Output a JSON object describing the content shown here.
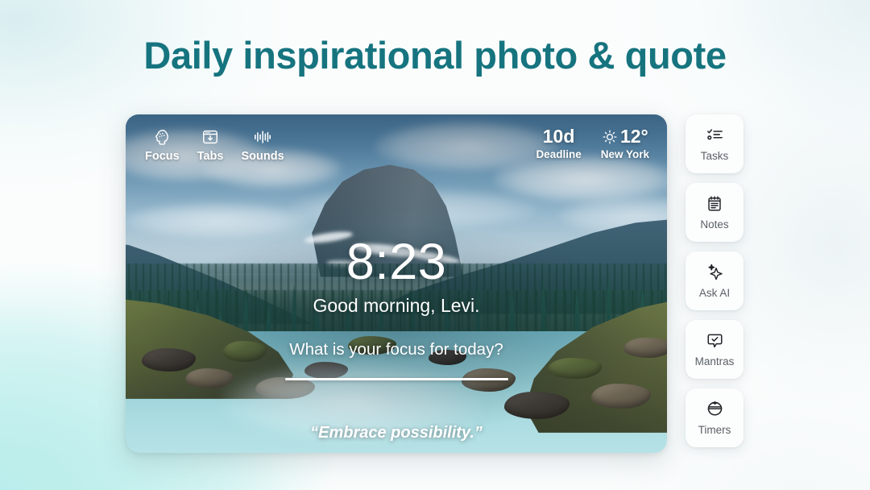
{
  "headline": "Daily inspirational photo & quote",
  "theme": {
    "headline_color": "#16747f",
    "background_tint": "#b8ecea",
    "card_surface": "#fcfdfd",
    "overlay_text": "#ffffff",
    "sidebar_label_color": "#5a6166"
  },
  "dashboard": {
    "toolbar": [
      {
        "label": "Focus",
        "icon": "brain-head-icon"
      },
      {
        "label": "Tabs",
        "icon": "window-download-icon"
      },
      {
        "label": "Sounds",
        "icon": "sound-waves-icon"
      }
    ],
    "stats": [
      {
        "value": "10d",
        "label": "Deadline",
        "icon": "none"
      },
      {
        "value": "12°",
        "label": "New York",
        "icon": "sun-icon"
      }
    ],
    "clock": "8:23",
    "greeting": "Good morning, Levi.",
    "focus_prompt": "What is your focus for today?",
    "focus_input_value": "",
    "quote": "“Embrace possibility.”"
  },
  "sidebar": {
    "items": [
      {
        "label": "Tasks",
        "icon": "checklist-icon"
      },
      {
        "label": "Notes",
        "icon": "notepad-icon"
      },
      {
        "label": "Ask AI",
        "icon": "sparkle-icon"
      },
      {
        "label": "Mantras",
        "icon": "speech-bubble-check-icon"
      },
      {
        "label": "Timers",
        "icon": "pomodoro-timer-icon"
      }
    ]
  }
}
